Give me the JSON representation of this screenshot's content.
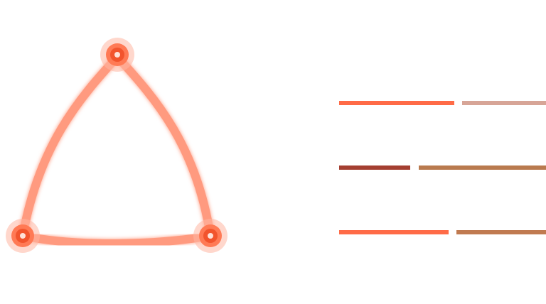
{
  "colors": {
    "background": "#ffffff",
    "edge": "#ff9a7f",
    "edge_glow": "#ffb8a6",
    "node_outer": "#ffb7a3",
    "node_mid": "#ff7a55",
    "node_core": "#f2542d",
    "node_center": "#ffe1d8"
  },
  "graphic": {
    "shape": "curved-triangle-loader",
    "nodes": [
      {
        "name": "top"
      },
      {
        "name": "bottom-left"
      },
      {
        "name": "bottom-right"
      }
    ]
  },
  "placeholder_lines": [
    {
      "name": "row-1",
      "segments": [
        {
          "color": "#ff6b47"
        },
        {
          "color": "#d7a597"
        }
      ]
    },
    {
      "name": "row-2",
      "segments": [
        {
          "color": "#a43f31"
        },
        {
          "color": "#b97a4f"
        }
      ]
    },
    {
      "name": "row-3",
      "segments": [
        {
          "color": "#ff6b47"
        },
        {
          "color": "#c07a50"
        }
      ]
    }
  ]
}
